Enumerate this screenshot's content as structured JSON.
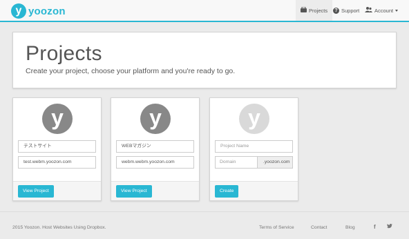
{
  "brand": {
    "logo_letter": "y",
    "name": "yoozon"
  },
  "nav": {
    "projects": {
      "icon": "projects-icon",
      "label": "Projects"
    },
    "support": {
      "icon": "question-circle-icon",
      "label": "Support"
    },
    "account": {
      "icon": "users-icon",
      "label": "Account"
    }
  },
  "jumbotron": {
    "title": "Projects",
    "subtitle": "Create your project, choose your platform and you're ready to go."
  },
  "projects": [
    {
      "avatar_letter": "y",
      "name": "テストサイト",
      "domain": "test.webm.yoozon.com",
      "button": "View Project"
    },
    {
      "avatar_letter": "y",
      "name": "WEBマガジン",
      "domain": "webm.webm.yoozon.com",
      "button": "View Project"
    }
  ],
  "new_project": {
    "avatar_letter": "y",
    "name_placeholder": "Project Name",
    "domain_placeholder": "Domain",
    "domain_suffix": ".yoozon.com",
    "button": "Create"
  },
  "footer": {
    "copyright": "2015 Yoozon. Host Websites Using Dropbox.",
    "links": [
      "Terms of Service",
      "Contact",
      "Blog"
    ],
    "social": {
      "facebook": "f",
      "twitter": "t"
    }
  },
  "colors": {
    "accent": "#29b7d3",
    "background": "#ebebeb"
  }
}
